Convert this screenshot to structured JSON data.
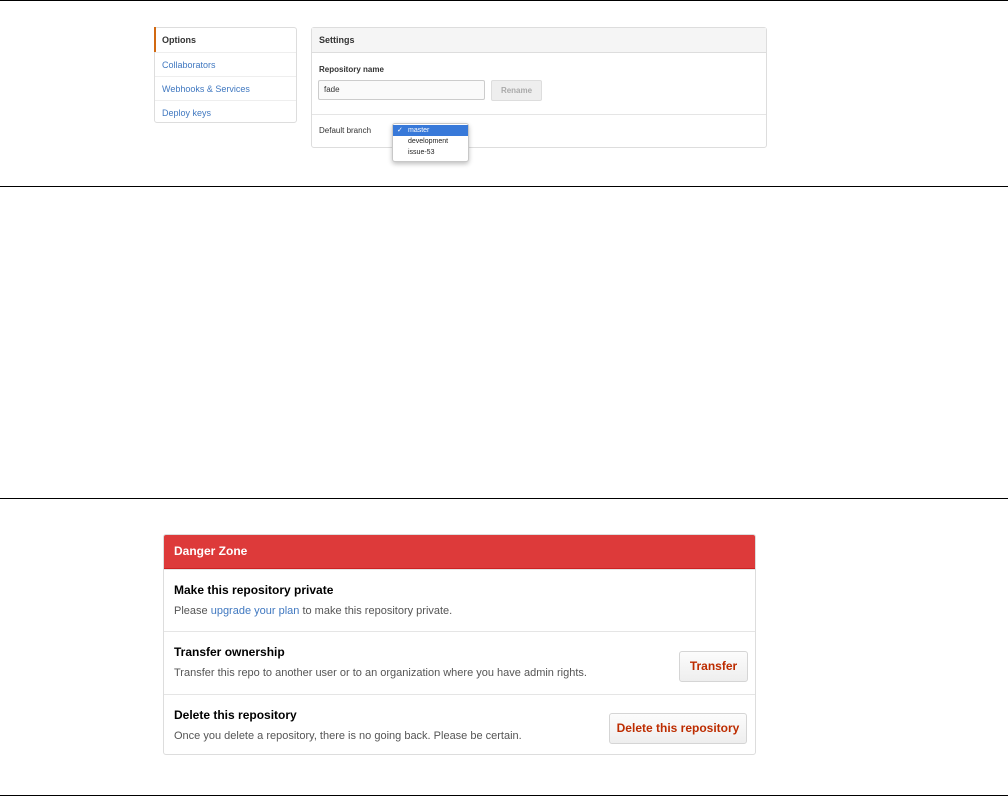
{
  "sidebar": {
    "items": [
      {
        "label": "Options",
        "active": true
      },
      {
        "label": "Collaborators"
      },
      {
        "label": "Webhooks & Services"
      },
      {
        "label": "Deploy keys"
      }
    ]
  },
  "settings": {
    "title": "Settings",
    "repo_name_label": "Repository name",
    "repo_name_value": "fade",
    "rename_label": "Rename",
    "default_branch_label": "Default branch",
    "branch_options": [
      "master",
      "development",
      "issue-53"
    ],
    "selected_branch": "master",
    "checkmark": "✓"
  },
  "danger_zone": {
    "title": "Danger Zone",
    "private": {
      "title": "Make this repository private",
      "desc_before": "Please ",
      "desc_link": "upgrade your plan",
      "desc_after": " to make this repository private."
    },
    "transfer": {
      "title": "Transfer ownership",
      "desc": "Transfer this repo to another user or to an organization where you have admin rights.",
      "button": "Transfer"
    },
    "delete": {
      "title": "Delete this repository",
      "desc": "Once you delete a repository, there is no going back. Please be certain.",
      "button": "Delete this repository"
    }
  },
  "colors": {
    "accent_active": "#d26911",
    "link": "#4078c0",
    "danger_header": "#dd3a3a",
    "danger_text": "#bd2c00",
    "dropdown_selected": "#3879d9"
  }
}
